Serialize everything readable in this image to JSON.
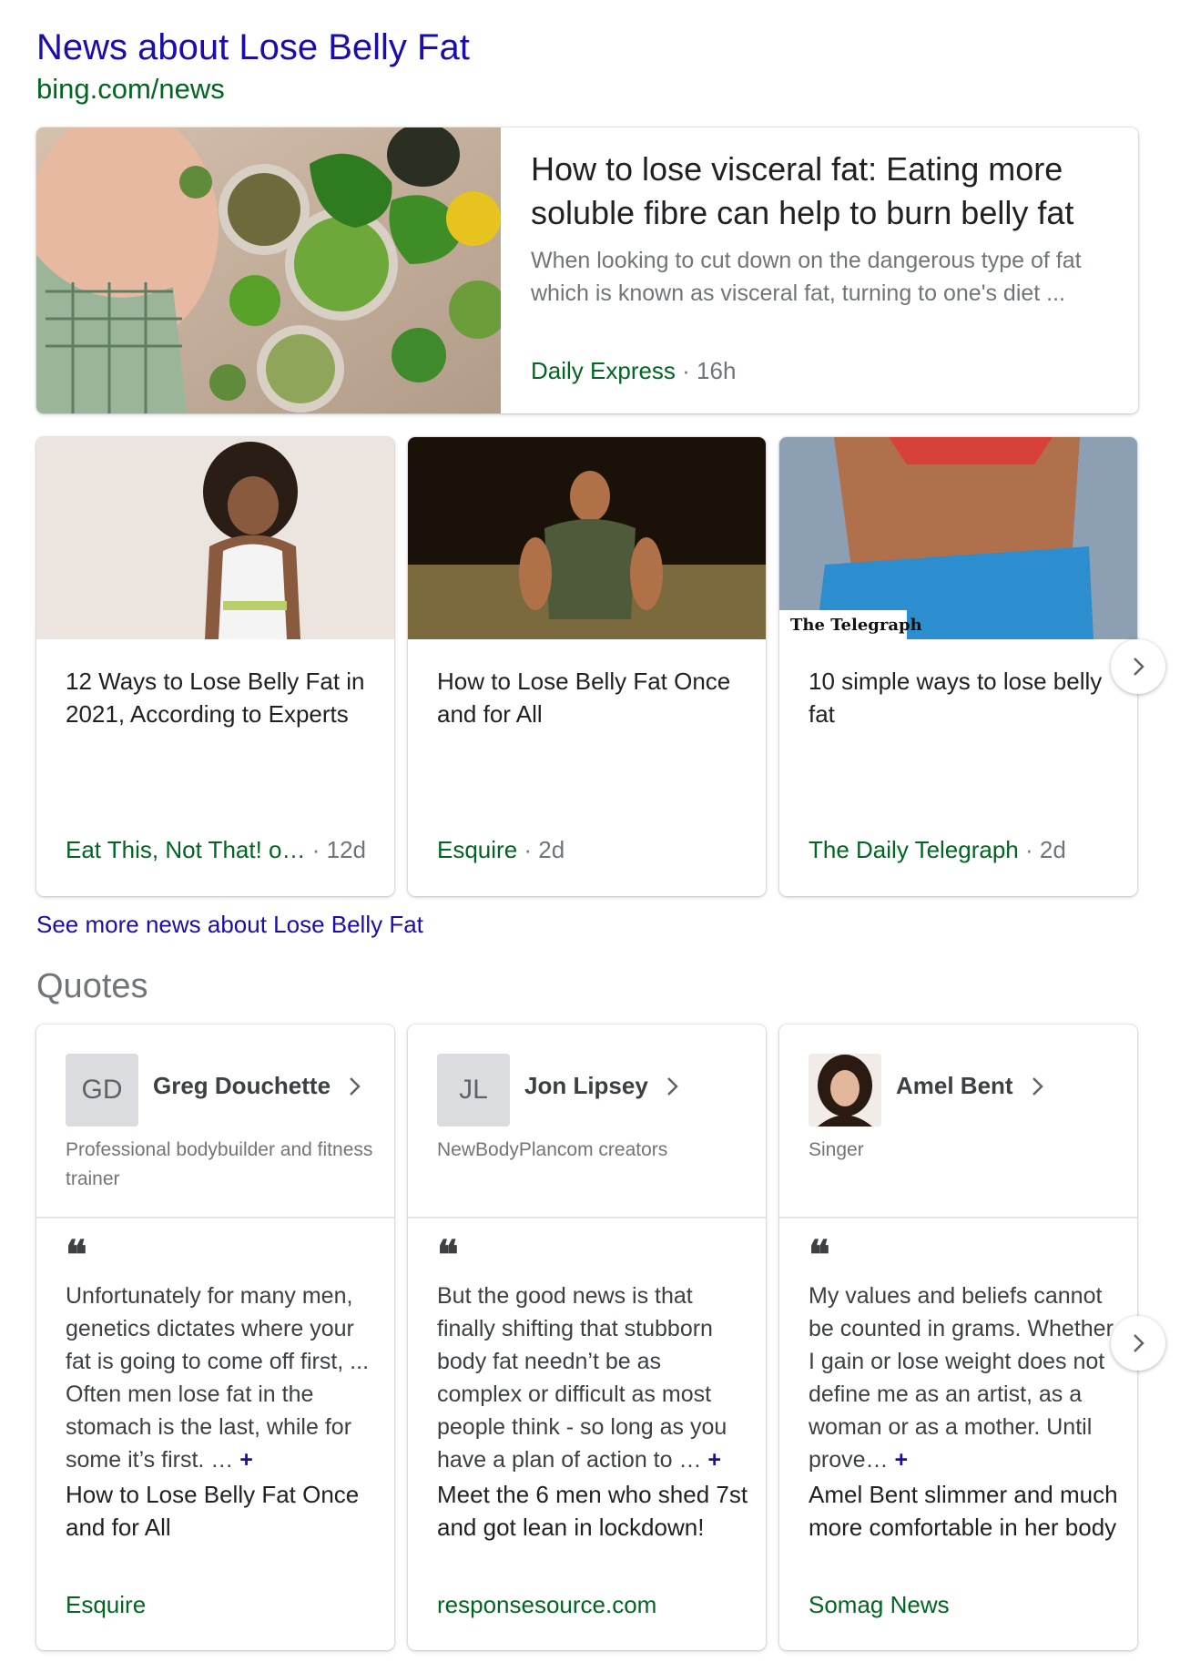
{
  "header": {
    "title": "News about Lose Belly Fat",
    "url": "bing.com/news"
  },
  "top_story": {
    "title": "How to lose visceral fat: Eating more soluble fibre can help to burn belly fat",
    "snippet": "When looking to cut down on the dangerous type of fat which is known as visceral fat, turning to one's diet ...",
    "source": "Daily Express",
    "age": "16h"
  },
  "news_cards": [
    {
      "title": "12 Ways to Lose Belly Fat in 2021, According to Experts",
      "source": "Eat This, Not That! o…",
      "age": "12d"
    },
    {
      "title": "How to Lose Belly Fat Once and for All",
      "source": "Esquire",
      "age": "2d"
    },
    {
      "title": "10 simple ways to lose belly fat",
      "source": "The Daily Telegraph",
      "age": "2d",
      "image_badge": "The Telegraph"
    }
  ],
  "see_more": "See more news about Lose Belly Fat",
  "quotes_heading": "Quotes",
  "quotes": [
    {
      "initials": "GD",
      "name": "Greg Douchette",
      "description": "Professional bodybuilder and fitness trainer",
      "quote": "Unfortunately for many men, genetics dictates where your fat is going to come off first, ... Often men lose fat in the stomach is the last, while for some it’s first. …",
      "article": "How to Lose Belly Fat Once and for All",
      "source": "Esquire"
    },
    {
      "initials": "JL",
      "name": "Jon Lipsey",
      "description": "NewBodyPlancom creators",
      "quote": "But the good news is that finally shifting that stubborn body fat needn’t be as complex or difficult as most people think - so long as you have a plan of action to …",
      "article": "Meet the 6 men who shed 7st and got lean in lockdown!",
      "source": "responsesource.com"
    },
    {
      "initials": "",
      "name": "Amel Bent",
      "description": "Singer",
      "quote": "My values and beliefs cannot be counted in grams. Whether I gain or lose weight does not define me as an artist, as a woman or as a mother. Until prove…",
      "article": "Amel Bent slimmer and much more comfortable in her body",
      "source": "Somag News"
    }
  ],
  "icons": {
    "next": "chevron-right-icon",
    "quote": "quote-mark-icon",
    "expand": "plus-icon",
    "person_link": "chevron-right-icon"
  },
  "colors": {
    "link": "#1a0dab",
    "source": "#006621",
    "muted": "#70757a"
  },
  "glyphs": {
    "quote_mark": "❝",
    "plus": "+",
    "dot": " · "
  }
}
